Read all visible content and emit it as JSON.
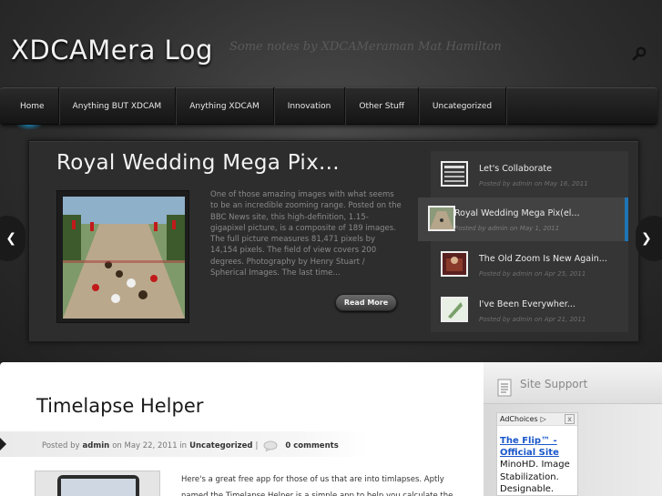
{
  "header": {
    "site_title": "XDCAMera Log",
    "tagline": "Some notes by XDCAMeraman Mat Hamilton"
  },
  "nav": {
    "items": [
      {
        "label": "Home"
      },
      {
        "label": "Anything BUT XDCAM"
      },
      {
        "label": "Anything XDCAM"
      },
      {
        "label": "Innovation"
      },
      {
        "label": "Other Stuff"
      },
      {
        "label": "Uncategorized"
      }
    ],
    "active_index": 0
  },
  "featured": {
    "title": "Royal Wedding Mega Pix...",
    "excerpt": "One of those amazing images with what seems to be an incredible zooming range. Posted on the BBC News site, this high-definition, 1.15-gigapixel picture, is a composite of 189 images. The full picture measures 81,471 pixels by 14,154 pixels. The field of view covers 200 degrees. Photography by Henry Stuart / Spherical Images. The last time...",
    "read_more": "Read More",
    "list": [
      {
        "title": "Let's Collaborate",
        "meta": "Posted by admin on May 16, 2011"
      },
      {
        "title": "Royal Wedding Mega Pix(el...",
        "meta": "Posted by admin on May 1, 2011"
      },
      {
        "title": "The Old Zoom Is New Again...",
        "meta": "Posted by admin on Apr 25, 2011"
      },
      {
        "title": "I've Been Everywher...",
        "meta": "Posted by admin on Apr 21, 2011"
      }
    ],
    "active_index": 1
  },
  "post": {
    "title": "Timelapse Helper",
    "posted_by_prefix": "Posted by",
    "author": "admin",
    "date_prefix": "on May 22, 2011 in",
    "category": "Uncategorized",
    "separator": "|",
    "comments": "0 comments",
    "body": "Here's a great free app for those of us that are into timlapses. Aptly named the Timelapse Helper is a simple app to help you calculate the"
  },
  "sidebar": {
    "title": "Site Support",
    "ad": {
      "choices_label": "AdChoices",
      "close": "x",
      "link": "The Flip™ - Official Site",
      "text": "MinoHD. Image Stabilization. Designable."
    }
  },
  "colors": {
    "accent_blue": "#1f74b3",
    "nav_bg": "#1e1e1e",
    "ad_link": "#1a57c9"
  }
}
